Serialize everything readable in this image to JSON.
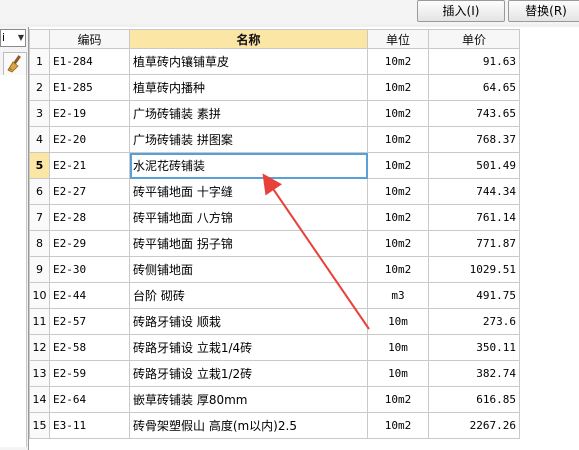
{
  "toolbar": {
    "insert_label": "插入(I)",
    "replace_label": "替换(R)"
  },
  "left_panel": {
    "combo_value": "i",
    "brush_icon": "brush-icon"
  },
  "table": {
    "headers": {
      "code": "编码",
      "name": "名称",
      "unit": "单位",
      "price": "单价"
    },
    "rows": [
      {
        "num": "1",
        "code": "E1-284",
        "name": "植草砖内镶铺草皮",
        "unit": "10m2",
        "price": "91.63"
      },
      {
        "num": "2",
        "code": "E1-285",
        "name": "植草砖内播种",
        "unit": "10m2",
        "price": "64.65"
      },
      {
        "num": "3",
        "code": "E2-19",
        "name": "广场砖铺装 素拼",
        "unit": "10m2",
        "price": "743.65"
      },
      {
        "num": "4",
        "code": "E2-20",
        "name": "广场砖铺装 拼图案",
        "unit": "10m2",
        "price": "768.37"
      },
      {
        "num": "5",
        "code": "E2-21",
        "name": "水泥花砖铺装",
        "unit": "10m2",
        "price": "501.49"
      },
      {
        "num": "6",
        "code": "E2-27",
        "name": "砖平铺地面 十字缝",
        "unit": "10m2",
        "price": "744.34"
      },
      {
        "num": "7",
        "code": "E2-28",
        "name": "砖平铺地面 八方锦",
        "unit": "10m2",
        "price": "761.14"
      },
      {
        "num": "8",
        "code": "E2-29",
        "name": "砖平铺地面 拐子锦",
        "unit": "10m2",
        "price": "771.87"
      },
      {
        "num": "9",
        "code": "E2-30",
        "name": "砖侧铺地面",
        "unit": "10m2",
        "price": "1029.51"
      },
      {
        "num": "10",
        "code": "E2-44",
        "name": "台阶 砌砖",
        "unit": "m3",
        "price": "491.75"
      },
      {
        "num": "11",
        "code": "E2-57",
        "name": "砖路牙铺设 顺栽",
        "unit": "10m",
        "price": "273.6"
      },
      {
        "num": "12",
        "code": "E2-58",
        "name": "砖路牙铺设 立栽1/4砖",
        "unit": "10m",
        "price": "350.11"
      },
      {
        "num": "13",
        "code": "E2-59",
        "name": "砖路牙铺设 立栽1/2砖",
        "unit": "10m",
        "price": "382.74"
      },
      {
        "num": "14",
        "code": "E2-64",
        "name": "嵌草砖铺装 厚80mm",
        "unit": "10m2",
        "price": "616.85"
      },
      {
        "num": "15",
        "code": "E3-11",
        "name": "砖骨架塑假山 高度(m以内)2.5",
        "unit": "10m2",
        "price": "2267.26"
      }
    ],
    "active_row": "5"
  },
  "colors": {
    "highlight": "#fbe6a6",
    "selection": "#5aa0d8",
    "arrow": "#e8413a"
  }
}
